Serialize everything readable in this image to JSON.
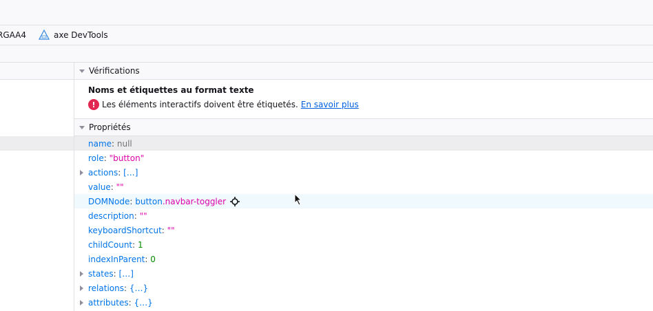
{
  "toolbar": {
    "tabs": [
      {
        "label": "RGAA4"
      },
      {
        "label": "axe DevTools",
        "icon": "axe-icon"
      }
    ]
  },
  "checks": {
    "header": "Vérifications",
    "title": "Noms et étiquettes au format texte",
    "message": "Les éléments interactifs doivent être étiquetés.",
    "link": "En savoir plus",
    "status_icon": "error-icon",
    "error_color": "#e22850"
  },
  "properties": {
    "header": "Propriétés",
    "rows": [
      {
        "key": "name",
        "value": "null"
      },
      {
        "key": "role",
        "value": "\"button\""
      },
      {
        "key": "actions",
        "value": "[…]"
      },
      {
        "key": "value",
        "value": "\"\""
      },
      {
        "key": "DOMNode",
        "tag": "button",
        "cls": ".navbar-toggler"
      },
      {
        "key": "description",
        "value": "\"\""
      },
      {
        "key": "keyboardShortcut",
        "value": "\"\""
      },
      {
        "key": "childCount",
        "value": "1"
      },
      {
        "key": "indexInParent",
        "value": "0"
      },
      {
        "key": "states",
        "value": "[…]"
      },
      {
        "key": "relations",
        "value": "{…}"
      },
      {
        "key": "attributes",
        "value": "{…}"
      }
    ]
  }
}
